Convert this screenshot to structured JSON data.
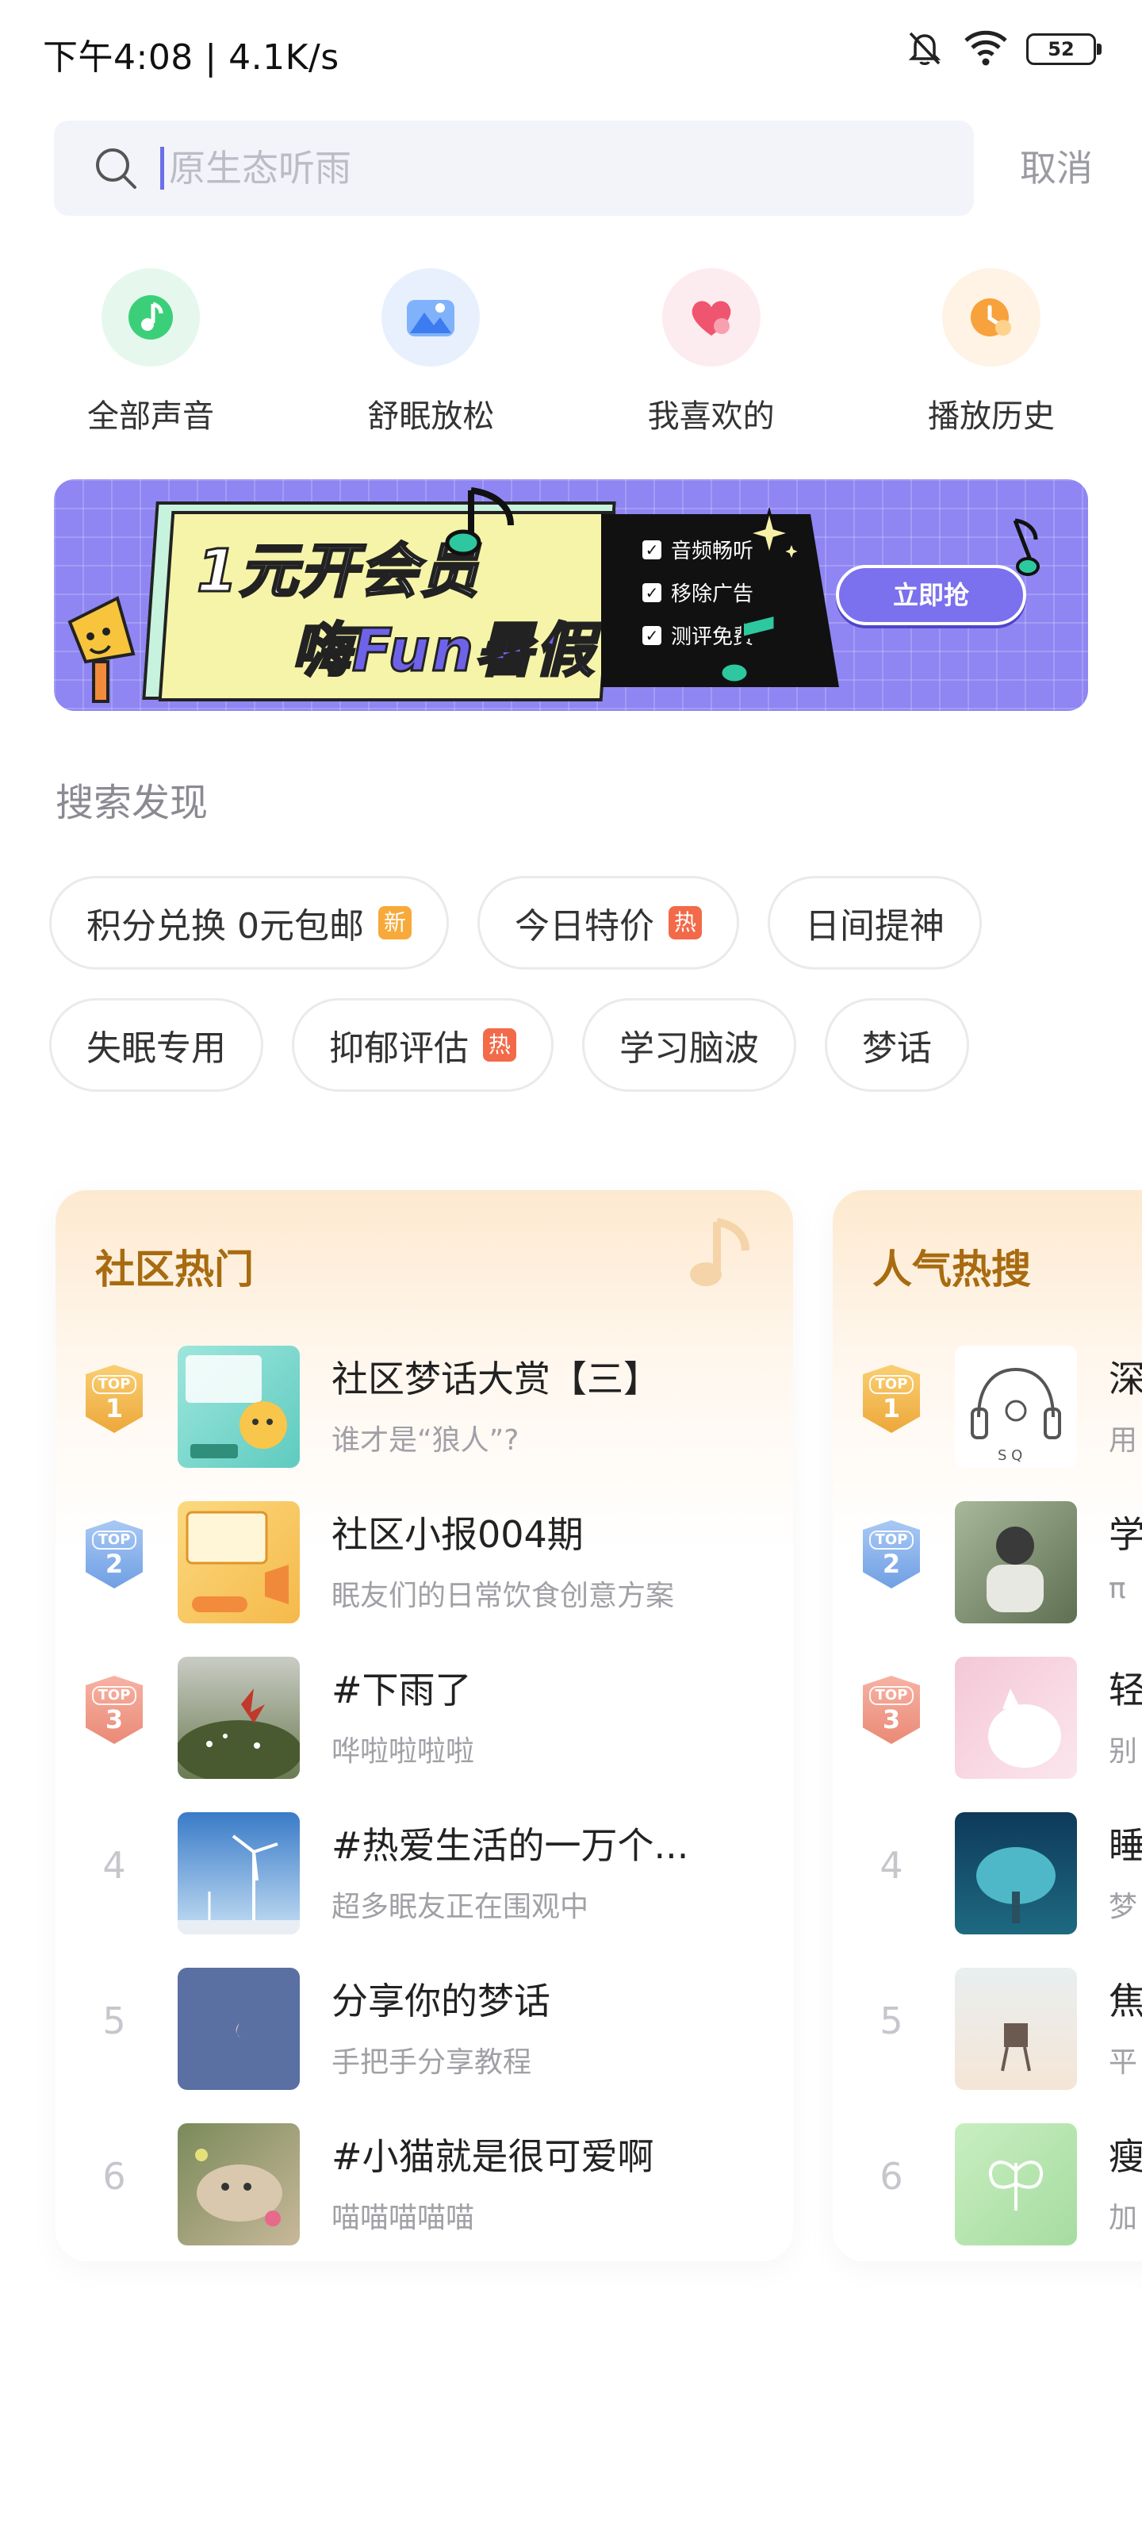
{
  "status_bar": {
    "time": "下午4:08 | 4.1K/s",
    "battery": "52"
  },
  "search": {
    "placeholder": "原生态听雨",
    "cancel_label": "取消"
  },
  "quick_nav": [
    {
      "label": "全部声音",
      "icon": "music-note-icon",
      "color": "#3ccf7a"
    },
    {
      "label": "舒眠放松",
      "icon": "mountain-icon",
      "color": "#4a8cf7"
    },
    {
      "label": "我喜欢的",
      "icon": "heart-icon",
      "color": "#f0556f"
    },
    {
      "label": "播放历史",
      "icon": "clock-icon",
      "color": "#f7a23c"
    }
  ],
  "banner": {
    "title_line1": "1元开会员",
    "title_line2": "嗨Fun暑假",
    "features": [
      "音频畅听",
      "移除广告",
      "测评免费"
    ],
    "button_label": "立即抢"
  },
  "discover": {
    "title": "搜索发现",
    "rows": [
      [
        {
          "label": "积分兑换 0元包邮",
          "badge": "新",
          "badge_color": "#f7a93a"
        },
        {
          "label": "今日特价",
          "badge": "热",
          "badge_color": "#f26a4a"
        },
        {
          "label": "日间提神",
          "badge": "",
          "badge_color": ""
        }
      ],
      [
        {
          "label": "失眠专用",
          "badge": "",
          "badge_color": ""
        },
        {
          "label": "抑郁评估",
          "badge": "热",
          "badge_color": "#f26a4a"
        },
        {
          "label": "学习脑波",
          "badge": "",
          "badge_color": ""
        },
        {
          "label": "梦话",
          "badge": "",
          "badge_color": ""
        }
      ]
    ]
  },
  "community_hot": {
    "title": "社区热门",
    "items": [
      {
        "rank": "1",
        "top": "TOP",
        "title": "社区梦话大赏【三】",
        "sub": "谁才是“狼人”?"
      },
      {
        "rank": "2",
        "top": "TOP",
        "title": "社区小报004期",
        "sub": "眠友们的日常饮食创意方案"
      },
      {
        "rank": "3",
        "top": "TOP",
        "title": "#下雨了",
        "sub": "哗啦啦啦啦"
      },
      {
        "rank": "4",
        "top": "",
        "title": "#热爱生活的一万个...",
        "sub": "超多眠友正在围观中"
      },
      {
        "rank": "5",
        "top": "",
        "title": "分享你的梦话",
        "sub": "手把手分享教程"
      },
      {
        "rank": "6",
        "top": "",
        "title": "#小猫就是很可爱啊",
        "sub": "喵喵喵喵喵"
      }
    ]
  },
  "popular_search": {
    "title": "人气热搜",
    "items": [
      {
        "rank": "1",
        "top": "TOP",
        "title": "深",
        "sub": "用"
      },
      {
        "rank": "2",
        "top": "TOP",
        "title": "学",
        "sub": "π"
      },
      {
        "rank": "3",
        "top": "TOP",
        "title": "轻",
        "sub": "别"
      },
      {
        "rank": "4",
        "top": "",
        "title": "睡",
        "sub": "梦"
      },
      {
        "rank": "5",
        "top": "",
        "title": "焦",
        "sub": "平"
      },
      {
        "rank": "6",
        "top": "",
        "title": "瘦",
        "sub": "加"
      }
    ]
  },
  "colors": {
    "top1": "#f2b64a",
    "top2": "#7aa9e8",
    "top3": "#f08c78",
    "card_title": "#a86b10"
  }
}
